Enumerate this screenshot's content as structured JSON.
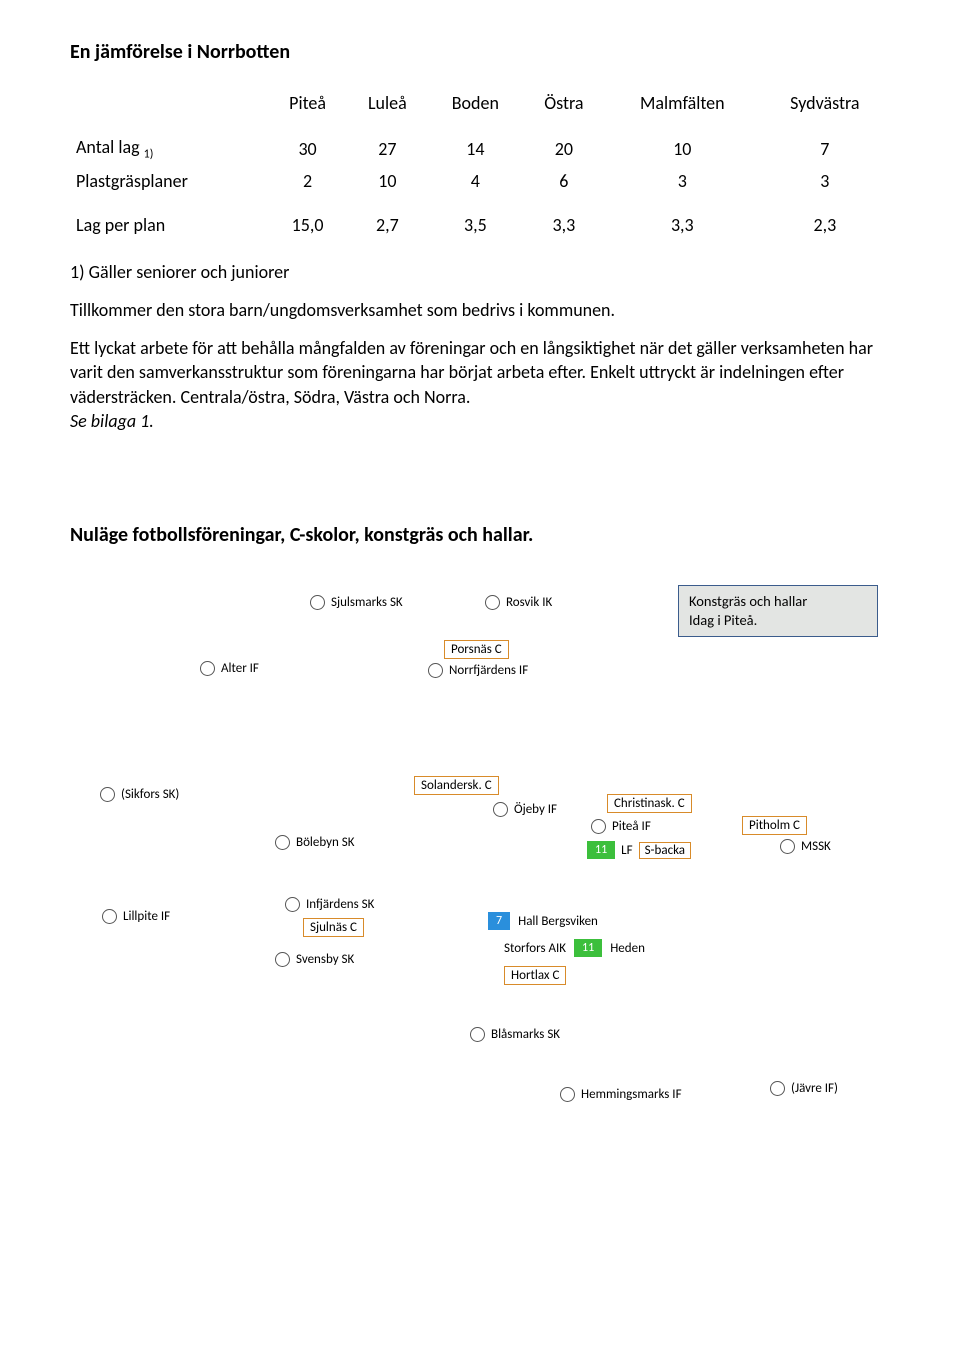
{
  "title": "En jämförelse i Norrbotten",
  "table": {
    "columns": [
      "Piteå",
      "Luleå",
      "Boden",
      "Östra",
      "Malmfälten",
      "Sydvästra"
    ],
    "rows": [
      {
        "label_prefix": "Antal lag ",
        "label_sub": "1)",
        "values": [
          "30",
          "27",
          "14",
          "20",
          "10",
          "7"
        ]
      },
      {
        "label": "Plastgräsplaner",
        "values": [
          "2",
          "10",
          "4",
          "6",
          "3",
          "3"
        ]
      },
      {
        "label": "Lag per plan",
        "values": [
          "15,0",
          "2,7",
          "3,5",
          "3,3",
          "3,3",
          "2,3"
        ]
      }
    ]
  },
  "note1": "1) Gäller seniorer och juniorer",
  "para1": "Tillkommer den stora barn/ungdomsverksamhet som bedrivs i kommunen.",
  "para2": "Ett lyckat arbete för att behålla mångfalden av föreningar och en långsiktighet när det gäller verksamheten har varit den samverkansstruktur som föreningarna har börjat arbeta efter. Enkelt uttryckt är indelningen efter vädersträcken. Centrala/östra, Södra, Västra och Norra.",
  "para2_tail": "Se bilaga 1.",
  "section2": "Nuläge fotbollsföreningar, C-skolor, konstgräs och hallar.",
  "diagram": {
    "infobox": {
      "line1": "Konstgräs och hallar",
      "line2": "Idag i Piteå."
    },
    "items": {
      "sjulsmarks": "Sjulsmarks SK",
      "rosvik": "Rosvik IK",
      "porsnas": "Porsnäs C",
      "alter": "Alter IF",
      "norrfjarden": "Norrfjärdens IF",
      "sikfors": "(Sikfors SK)",
      "solandersk": "Solandersk. C",
      "ojeby": "Öjeby IF",
      "christinask": "Christinask. C",
      "bolebyn": "Bölebyn SK",
      "pitea_if": "Piteå IF",
      "pitholm": "Pitholm C",
      "mssk": "MSSK",
      "lf": "LF",
      "sbacka": "S-backa",
      "num11a": "11",
      "lillpite": "Lillpite IF",
      "infjarden": "Infjärdens SK",
      "sjulnas": "Sjulnäs C",
      "svensby": "Svensby SK",
      "num7": "7",
      "hall": "Hall Bergsviken",
      "storfors": "Storfors AIK",
      "num11b": "11",
      "heden": "Heden",
      "hortlax": "Hortlax C",
      "blasmarks": "Blåsmarks SK",
      "hemmingsmarks": "Hemmingsmarks IF",
      "javre": "(Jävre IF)"
    }
  }
}
